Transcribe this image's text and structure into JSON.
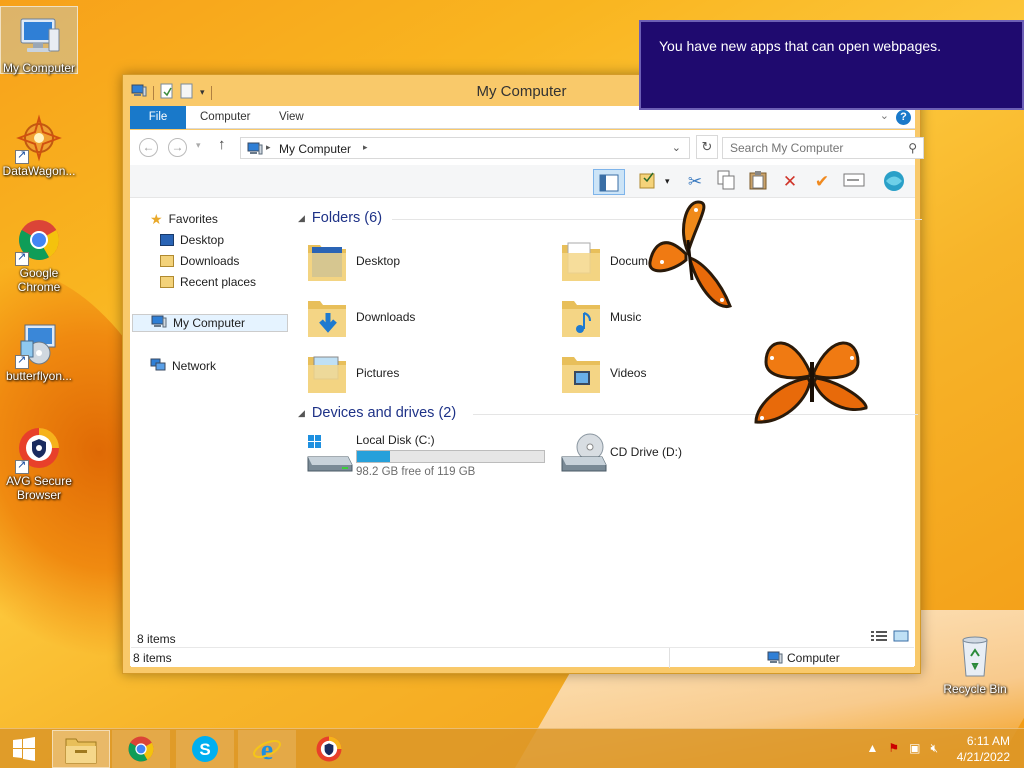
{
  "desktop": {
    "icons": [
      {
        "label": "My Computer"
      },
      {
        "label": "DataWagon..."
      },
      {
        "label": "Google Chrome"
      },
      {
        "label": "butterflyon..."
      },
      {
        "label": "AVG Secure Browser"
      },
      {
        "label": "Recycle Bin"
      }
    ]
  },
  "notification": {
    "text": "You have new apps that can open webpages."
  },
  "window": {
    "title": "My Computer",
    "tabs": {
      "file": "File",
      "computer": "Computer",
      "view": "View"
    },
    "help": "?",
    "address": {
      "path": "My Computer"
    },
    "search": {
      "placeholder": "Search My Computer"
    },
    "nav": {
      "favorites": "Favorites",
      "desktop": "Desktop",
      "downloads": "Downloads",
      "recent": "Recent places",
      "my_computer": "My Computer",
      "network": "Network"
    },
    "folders_header": "Folders (6)",
    "folders": [
      {
        "label": "Desktop"
      },
      {
        "label": "Docum"
      },
      {
        "label": "Downloads"
      },
      {
        "label": "Music"
      },
      {
        "label": "Pictures"
      },
      {
        "label": "Videos"
      }
    ],
    "devices_header": "Devices and drives (2)",
    "drives": {
      "c": {
        "label": "Local Disk (C:)",
        "free": "98.2 GB free of 119 GB",
        "used_fraction": 0.175
      },
      "d": {
        "label": "CD Drive (D:)"
      }
    },
    "item_count": "8 items",
    "status": {
      "items": "8 items",
      "location": "Computer"
    }
  },
  "taskbar": {
    "clock_time": "6:11 AM",
    "clock_date": "4/21/2022"
  },
  "colors": {
    "accent": "#1979ca",
    "toast_bg": "#1f0a6f",
    "group_header": "#1e3287",
    "disk_fill": "#26a0da"
  }
}
